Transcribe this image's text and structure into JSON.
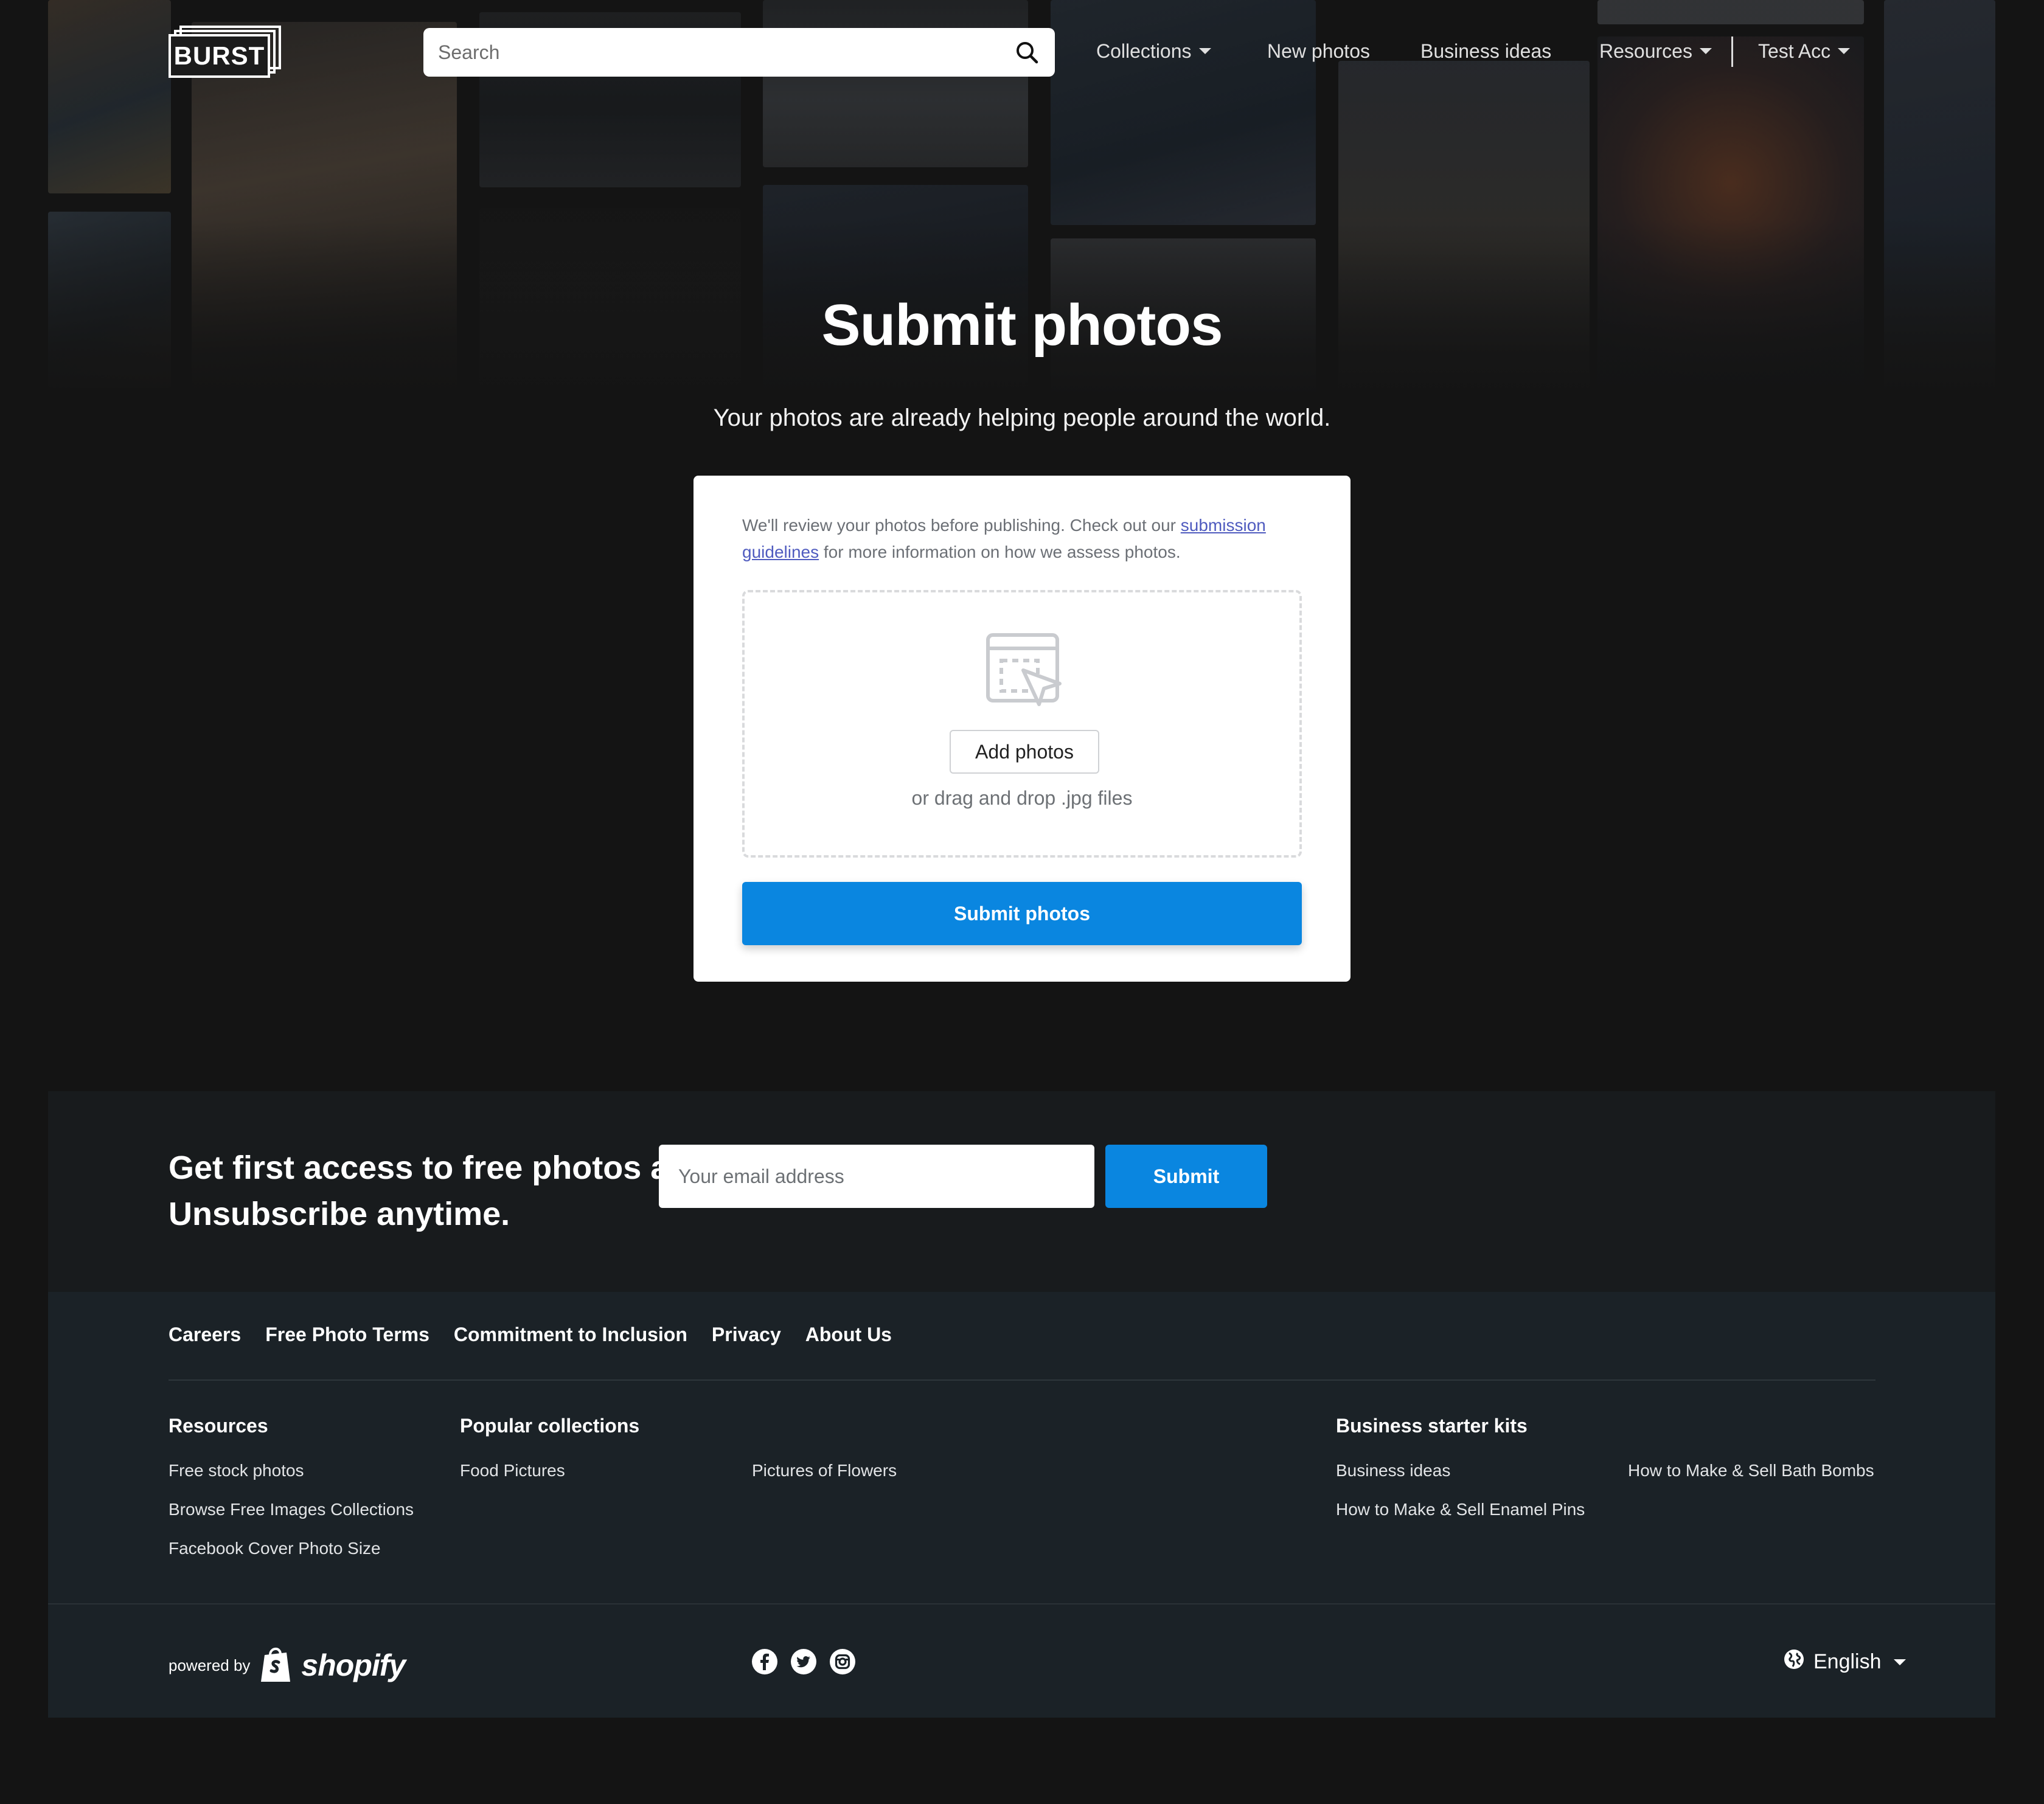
{
  "header": {
    "logo_text": "BURST",
    "search_placeholder": "Search",
    "nav": {
      "collections": "Collections",
      "new_photos": "New photos",
      "business_ideas": "Business ideas",
      "resources": "Resources",
      "account": "Test Acc"
    }
  },
  "hero": {
    "title": "Submit photos",
    "subtitle": "Your photos are already helping people around the world."
  },
  "submission": {
    "note_before": "We'll review your photos before publishing. Check out our ",
    "note_link": "submission guidelines",
    "note_after": " for more information on how we assess photos.",
    "add_button": "Add photos",
    "drop_hint": "or drag and drop .jpg files",
    "submit_button": "Submit photos"
  },
  "newsletter": {
    "heading": "Get first access to free photos and other Burst content. Unsubscribe anytime.",
    "email_placeholder": "Your email address",
    "submit_button": "Submit"
  },
  "footer": {
    "links": [
      "Careers",
      "Free Photo Terms",
      "Commitment to Inclusion",
      "Privacy",
      "About Us"
    ],
    "resources": {
      "heading": "Resources",
      "items": [
        "Free stock photos",
        "Browse Free Images Collections",
        "Facebook Cover Photo Size"
      ]
    },
    "popular": {
      "heading": "Popular collections",
      "items": [
        "Food Pictures",
        "Pictures of Flowers"
      ]
    },
    "business": {
      "heading": "Business starter kits",
      "items": [
        "Business ideas",
        "How to Make & Sell Bath Bombs",
        "How to Make & Sell Enamel Pins"
      ]
    },
    "powered_by": "powered by",
    "shopify": "shopify",
    "social": [
      "facebook-icon",
      "twitter-icon",
      "instagram-icon"
    ],
    "language": "English"
  },
  "colors": {
    "page_bg": "#141414",
    "primary_button": "#0a86e0",
    "link": "#4f5bbf",
    "footer_bg": "#1b2227"
  }
}
